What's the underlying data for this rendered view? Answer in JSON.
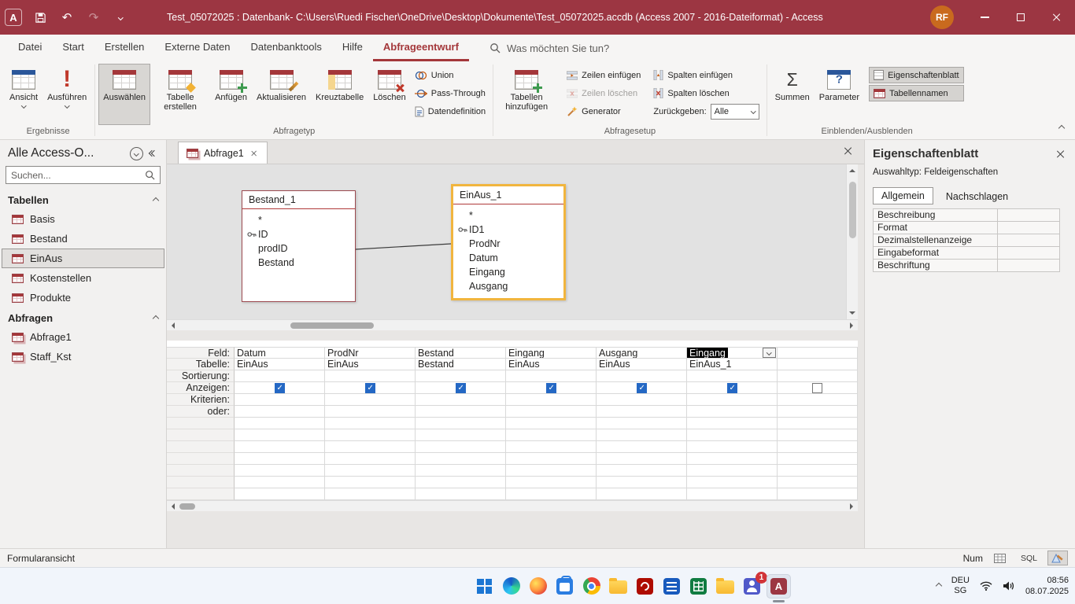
{
  "glyphs": {
    "app_letter": "A",
    "undo": "↶",
    "redo": "↷",
    "sigma": "Σ",
    "exclamation": "!",
    "question": "?"
  },
  "titlebar": {
    "title": "Test_05072025 : Datenbank- C:\\Users\\Ruedi Fischer\\OneDrive\\Desktop\\Dokumente\\Test_05072025.accdb (Access 2007 - 2016-Dateiformat)  -  Access",
    "avatar": "RF"
  },
  "ribbon": {
    "tabs": [
      {
        "label": "Datei"
      },
      {
        "label": "Start"
      },
      {
        "label": "Erstellen"
      },
      {
        "label": "Externe Daten"
      },
      {
        "label": "Datenbanktools"
      },
      {
        "label": "Hilfe"
      },
      {
        "label": "Abfrageentwurf"
      }
    ],
    "search_placeholder": "Was möchten Sie tun?",
    "ergebnisse": {
      "label": "Ergebnisse",
      "ansicht": "Ansicht",
      "ausfuehren": "Ausführen"
    },
    "abfragetyp": {
      "label": "Abfragetyp",
      "auswaehlen": "Auswählen",
      "tabelle_erstellen": "Tabelle erstellen",
      "anfuegen": "Anfügen",
      "aktualisieren": "Aktualisieren",
      "kreuztabelle": "Kreuztabelle",
      "loeschen": "Löschen",
      "union": "Union",
      "pass_through": "Pass-Through",
      "datendefinition": "Datendefinition"
    },
    "abfragesetup": {
      "label": "Abfragesetup",
      "tabellen_hinzufuegen": "Tabellen hinzufügen",
      "zeilen_einfuegen": "Zeilen einfügen",
      "zeilen_loeschen": "Zeilen löschen",
      "spalten_einfuegen": "Spalten einfügen",
      "spalten_loeschen": "Spalten löschen",
      "generator": "Generator",
      "zurueckgeben_label": "Zurückgeben:",
      "zurueckgeben_value": "Alle"
    },
    "einblenden": {
      "label": "Einblenden/Ausblenden",
      "summen": "Summen",
      "parameter": "Parameter",
      "eigenschaftenblatt": "Eigenschaftenblatt",
      "tabellennamen": "Tabellennamen"
    }
  },
  "sidebar": {
    "title": "Alle Access-O...",
    "search_placeholder": "Suchen...",
    "sections": [
      {
        "label": "Tabellen",
        "items": [
          {
            "label": "Basis"
          },
          {
            "label": "Bestand"
          },
          {
            "label": "EinAus"
          },
          {
            "label": "Kostenstellen"
          },
          {
            "label": "Produkte"
          }
        ]
      },
      {
        "label": "Abfragen",
        "items": [
          {
            "label": "Abfrage1"
          },
          {
            "label": "Staff_Kst"
          }
        ]
      }
    ]
  },
  "document": {
    "tab": "Abfrage1",
    "tables": [
      {
        "name": "Bestand_1",
        "fields": [
          "*",
          "ID",
          "prodID",
          "Bestand"
        ]
      },
      {
        "name": "EinAus_1",
        "fields": [
          "*",
          "ID1",
          "ProdNr",
          "Datum",
          "Eingang",
          "Ausgang"
        ]
      }
    ],
    "grid": {
      "row_labels": [
        "Feld:",
        "Tabelle:",
        "Sortierung:",
        "Anzeigen:",
        "Kriterien:",
        "oder:"
      ],
      "columns": [
        {
          "feld": "Datum",
          "tabelle": "EinAus"
        },
        {
          "feld": "ProdNr",
          "tabelle": "EinAus"
        },
        {
          "feld": "Bestand",
          "tabelle": "Bestand"
        },
        {
          "feld": "Eingang",
          "tabelle": "EinAus"
        },
        {
          "feld": "Ausgang",
          "tabelle": "EinAus"
        },
        {
          "feld": "Eingang",
          "tabelle": "EinAus_1"
        },
        {
          "feld": "",
          "tabelle": ""
        }
      ]
    }
  },
  "property_sheet": {
    "title": "Eigenschaftenblatt",
    "selection_type": "Auswahltyp: Feldeigenschaften",
    "tabs": [
      {
        "label": "Allgemein"
      },
      {
        "label": "Nachschlagen"
      }
    ],
    "properties": [
      {
        "label": "Beschreibung",
        "value": ""
      },
      {
        "label": "Format",
        "value": ""
      },
      {
        "label": "Dezimalstellenanzeige",
        "value": ""
      },
      {
        "label": "Eingabeformat",
        "value": ""
      },
      {
        "label": "Beschriftung",
        "value": ""
      }
    ]
  },
  "statusbar": {
    "view_label": "Formularansicht",
    "num": "Num",
    "sql": "SQL"
  },
  "taskbar": {
    "badge": "1",
    "access_letter": "A",
    "tray": {
      "lang1": "DEU",
      "lang2": "SG",
      "time": "08:56",
      "date": "08.07.2025"
    }
  }
}
